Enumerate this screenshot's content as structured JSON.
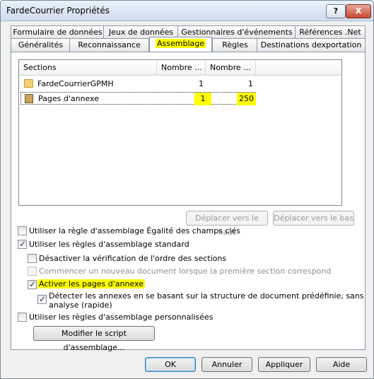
{
  "window": {
    "title": "FardeCourrier Propriétés",
    "help_glyph": "?",
    "close_glyph": "X"
  },
  "tabs_row1": [
    {
      "label": "Formulaire de données"
    },
    {
      "label": "Jeux de données"
    },
    {
      "label": "Gestionnaires d'événements"
    },
    {
      "label": "Références .Net"
    }
  ],
  "tabs_row2": [
    {
      "label": "Généralités"
    },
    {
      "label": "Reconnaissance"
    },
    {
      "label": "Assemblage"
    },
    {
      "label": "Règles"
    },
    {
      "label": "Destinations dexportation"
    }
  ],
  "sections": {
    "columns": [
      "Sections",
      "Nombre ...",
      "Nombre ..."
    ],
    "rows": [
      {
        "name": "FardeCourrierGPMH",
        "min": "1",
        "max": "1",
        "icon": "folder-icon"
      },
      {
        "name": "Pages d'annexe",
        "min": "1",
        "max": "250",
        "icon": "book-icon"
      }
    ]
  },
  "move_buttons": {
    "up": "Déplacer vers le haut",
    "down": "Déplacer vers le bas"
  },
  "options": {
    "equality_rule": "Utiliser la règle d'assemblage Égalité des champs clés",
    "standard_rules": "Utiliser les règles d'assemblage standard",
    "disable_order": "Désactiver la vérification de l'ordre des sections",
    "new_document": "Commencer un nouveau document lorsque la première section correspond",
    "activate_annex": "Activer les pages d'annexe",
    "detect_annex_l1": "Détecter les annexes en se basant sur la structure de document prédéfinie, sans",
    "detect_annex_l2": "analyse (rapide)",
    "custom_rules": "Utiliser les règles d'assemblage personnalisées",
    "edit_script": "Modifier le script d'assemblage..."
  },
  "footer": {
    "ok": "OK",
    "cancel": "Annuler",
    "apply": "Appliquer",
    "help": "Aide"
  },
  "colors": {
    "highlight": "#ffff00",
    "selected_tab_bg": "#ffffff"
  }
}
